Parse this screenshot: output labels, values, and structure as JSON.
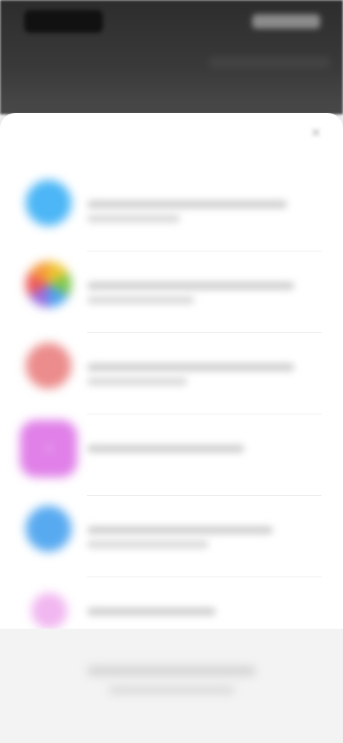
{
  "colors": {
    "header_bg": "#353535",
    "sheet_bg": "#ffffff",
    "page_bg": "#f3f3f3"
  },
  "status_bar": {
    "time": "",
    "indicators": ""
  },
  "sheet": {
    "title": "",
    "close_icon": "close-icon"
  },
  "items": [
    {
      "id": "item-1",
      "title": "",
      "subtitle": "",
      "icon": "app-icon-blue",
      "color": "#4cb6f6",
      "shape": "circle"
    },
    {
      "id": "item-2",
      "title": "",
      "subtitle": "",
      "icon": "app-icon-multicolor",
      "color": "#e9b02c",
      "shape": "circle"
    },
    {
      "id": "item-3",
      "title": "",
      "subtitle": "",
      "icon": "app-icon-red",
      "color": "#ec8c8c",
      "shape": "circle"
    },
    {
      "id": "item-4",
      "title": "",
      "subtitle": "",
      "icon": "app-icon-purple",
      "color": "#e080e8",
      "shape": "square"
    },
    {
      "id": "item-5",
      "title": "",
      "subtitle": "",
      "icon": "app-icon-blue-2",
      "color": "#58aaf0",
      "shape": "circle"
    },
    {
      "id": "item-6",
      "title": "",
      "subtitle": "",
      "icon": "app-icon-pink",
      "color": "#f1b7f0",
      "shape": "circle"
    }
  ],
  "footer": {
    "line1": "",
    "line2": ""
  }
}
